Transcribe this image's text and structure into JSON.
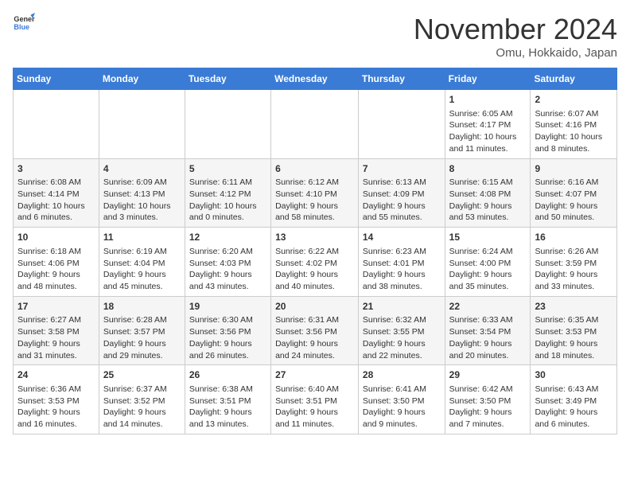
{
  "header": {
    "logo_general": "General",
    "logo_blue": "Blue",
    "month_title": "November 2024",
    "location": "Omu, Hokkaido, Japan"
  },
  "days_of_week": [
    "Sunday",
    "Monday",
    "Tuesday",
    "Wednesday",
    "Thursday",
    "Friday",
    "Saturday"
  ],
  "weeks": [
    [
      {
        "day": "",
        "info": ""
      },
      {
        "day": "",
        "info": ""
      },
      {
        "day": "",
        "info": ""
      },
      {
        "day": "",
        "info": ""
      },
      {
        "day": "",
        "info": ""
      },
      {
        "day": "1",
        "info": "Sunrise: 6:05 AM\nSunset: 4:17 PM\nDaylight: 10 hours and 11 minutes."
      },
      {
        "day": "2",
        "info": "Sunrise: 6:07 AM\nSunset: 4:16 PM\nDaylight: 10 hours and 8 minutes."
      }
    ],
    [
      {
        "day": "3",
        "info": "Sunrise: 6:08 AM\nSunset: 4:14 PM\nDaylight: 10 hours and 6 minutes."
      },
      {
        "day": "4",
        "info": "Sunrise: 6:09 AM\nSunset: 4:13 PM\nDaylight: 10 hours and 3 minutes."
      },
      {
        "day": "5",
        "info": "Sunrise: 6:11 AM\nSunset: 4:12 PM\nDaylight: 10 hours and 0 minutes."
      },
      {
        "day": "6",
        "info": "Sunrise: 6:12 AM\nSunset: 4:10 PM\nDaylight: 9 hours and 58 minutes."
      },
      {
        "day": "7",
        "info": "Sunrise: 6:13 AM\nSunset: 4:09 PM\nDaylight: 9 hours and 55 minutes."
      },
      {
        "day": "8",
        "info": "Sunrise: 6:15 AM\nSunset: 4:08 PM\nDaylight: 9 hours and 53 minutes."
      },
      {
        "day": "9",
        "info": "Sunrise: 6:16 AM\nSunset: 4:07 PM\nDaylight: 9 hours and 50 minutes."
      }
    ],
    [
      {
        "day": "10",
        "info": "Sunrise: 6:18 AM\nSunset: 4:06 PM\nDaylight: 9 hours and 48 minutes."
      },
      {
        "day": "11",
        "info": "Sunrise: 6:19 AM\nSunset: 4:04 PM\nDaylight: 9 hours and 45 minutes."
      },
      {
        "day": "12",
        "info": "Sunrise: 6:20 AM\nSunset: 4:03 PM\nDaylight: 9 hours and 43 minutes."
      },
      {
        "day": "13",
        "info": "Sunrise: 6:22 AM\nSunset: 4:02 PM\nDaylight: 9 hours and 40 minutes."
      },
      {
        "day": "14",
        "info": "Sunrise: 6:23 AM\nSunset: 4:01 PM\nDaylight: 9 hours and 38 minutes."
      },
      {
        "day": "15",
        "info": "Sunrise: 6:24 AM\nSunset: 4:00 PM\nDaylight: 9 hours and 35 minutes."
      },
      {
        "day": "16",
        "info": "Sunrise: 6:26 AM\nSunset: 3:59 PM\nDaylight: 9 hours and 33 minutes."
      }
    ],
    [
      {
        "day": "17",
        "info": "Sunrise: 6:27 AM\nSunset: 3:58 PM\nDaylight: 9 hours and 31 minutes."
      },
      {
        "day": "18",
        "info": "Sunrise: 6:28 AM\nSunset: 3:57 PM\nDaylight: 9 hours and 29 minutes."
      },
      {
        "day": "19",
        "info": "Sunrise: 6:30 AM\nSunset: 3:56 PM\nDaylight: 9 hours and 26 minutes."
      },
      {
        "day": "20",
        "info": "Sunrise: 6:31 AM\nSunset: 3:56 PM\nDaylight: 9 hours and 24 minutes."
      },
      {
        "day": "21",
        "info": "Sunrise: 6:32 AM\nSunset: 3:55 PM\nDaylight: 9 hours and 22 minutes."
      },
      {
        "day": "22",
        "info": "Sunrise: 6:33 AM\nSunset: 3:54 PM\nDaylight: 9 hours and 20 minutes."
      },
      {
        "day": "23",
        "info": "Sunrise: 6:35 AM\nSunset: 3:53 PM\nDaylight: 9 hours and 18 minutes."
      }
    ],
    [
      {
        "day": "24",
        "info": "Sunrise: 6:36 AM\nSunset: 3:53 PM\nDaylight: 9 hours and 16 minutes."
      },
      {
        "day": "25",
        "info": "Sunrise: 6:37 AM\nSunset: 3:52 PM\nDaylight: 9 hours and 14 minutes."
      },
      {
        "day": "26",
        "info": "Sunrise: 6:38 AM\nSunset: 3:51 PM\nDaylight: 9 hours and 13 minutes."
      },
      {
        "day": "27",
        "info": "Sunrise: 6:40 AM\nSunset: 3:51 PM\nDaylight: 9 hours and 11 minutes."
      },
      {
        "day": "28",
        "info": "Sunrise: 6:41 AM\nSunset: 3:50 PM\nDaylight: 9 hours and 9 minutes."
      },
      {
        "day": "29",
        "info": "Sunrise: 6:42 AM\nSunset: 3:50 PM\nDaylight: 9 hours and 7 minutes."
      },
      {
        "day": "30",
        "info": "Sunrise: 6:43 AM\nSunset: 3:49 PM\nDaylight: 9 hours and 6 minutes."
      }
    ]
  ]
}
